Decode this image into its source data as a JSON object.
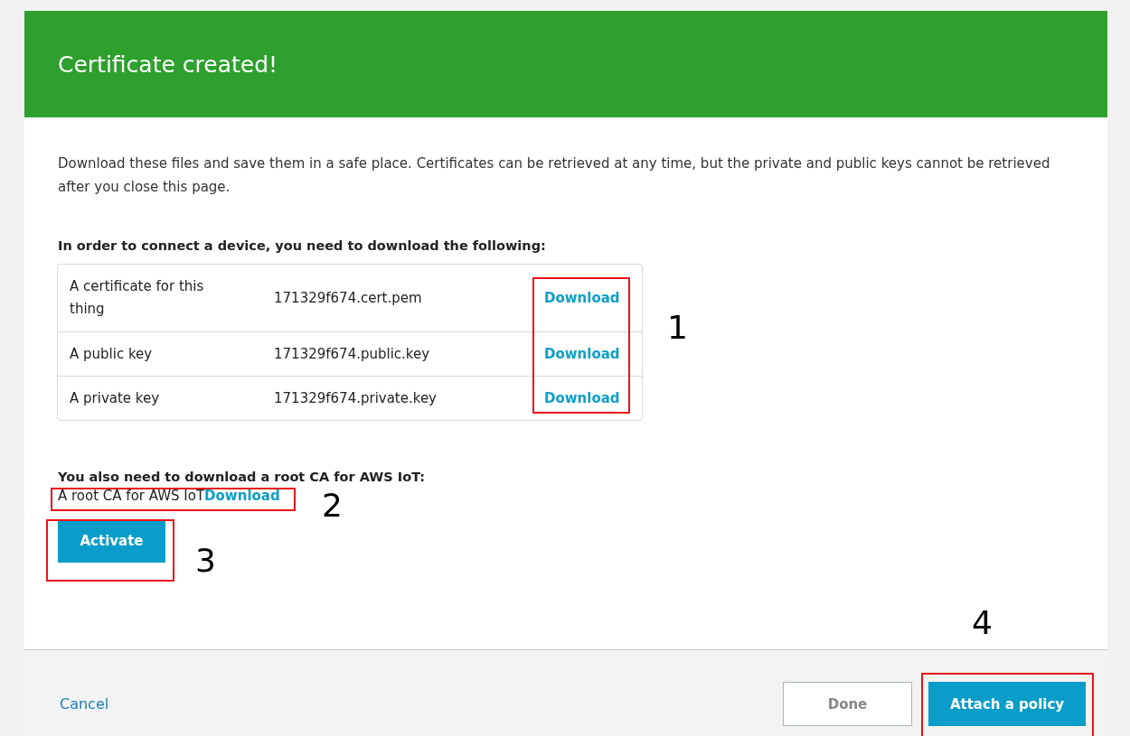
{
  "header": {
    "title": "Certificate created!"
  },
  "intro": "Download these files and save them in a safe place. Certificates can be retrieved at any time, but the private and public keys cannot be retrieved after you close this page.",
  "files_heading": "In order to connect a device, you need to download the following:",
  "files": [
    {
      "label": "A certificate for this thing",
      "file": "171329f674.cert.pem",
      "action": "Download"
    },
    {
      "label": "A public key",
      "file": "171329f674.public.key",
      "action": "Download"
    },
    {
      "label": "A private key",
      "file": "171329f674.private.key",
      "action": "Download"
    }
  ],
  "root_ca": {
    "heading": "You also need to download a root CA for AWS IoT:",
    "label": "A root CA for AWS IoT",
    "action": "Download"
  },
  "activate_button": "Activate",
  "footer": {
    "cancel": "Cancel",
    "buttons": [
      {
        "label": "Done",
        "disabled": true
      },
      {
        "label": "Attach a policy",
        "disabled": false
      }
    ]
  },
  "annotations": [
    {
      "label": "1"
    },
    {
      "label": "2"
    },
    {
      "label": "3"
    },
    {
      "label": "4"
    }
  ]
}
